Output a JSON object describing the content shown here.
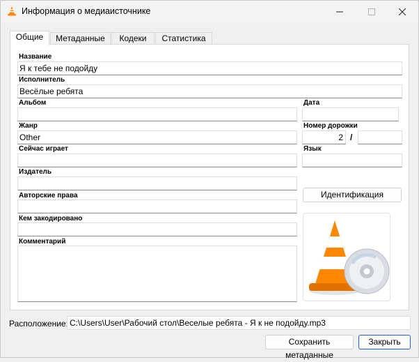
{
  "window": {
    "title": "Информация о медиаисточнике",
    "icon": "vlc-cone-icon",
    "controls": [
      "minimize-icon",
      "maximize-icon",
      "close-icon"
    ]
  },
  "tabs": [
    {
      "label": "Общие",
      "active": true
    },
    {
      "label": "Метаданные",
      "active": false
    },
    {
      "label": "Кодеки",
      "active": false
    },
    {
      "label": "Статистика",
      "active": false
    }
  ],
  "general": {
    "title": {
      "label": "Название",
      "value": "Я к тебе не подойду"
    },
    "artist": {
      "label": "Исполнитель",
      "value": "Весёлые ребята"
    },
    "album": {
      "label": "Альбом",
      "value": ""
    },
    "date": {
      "label": "Дата",
      "value": ""
    },
    "genre": {
      "label": "Жанр",
      "value": "Other"
    },
    "track": {
      "label": "Номер дорожки",
      "number": "2",
      "separator": "/",
      "total": ""
    },
    "now_playing": {
      "label": "Сейчас играет",
      "value": ""
    },
    "language": {
      "label": "Язык",
      "value": ""
    },
    "publisher": {
      "label": "Издатель",
      "value": ""
    },
    "copyright": {
      "label": "Авторские права",
      "value": ""
    },
    "encoded_by": {
      "label": "Кем закодировано",
      "value": ""
    },
    "comment": {
      "label": "Комментарий",
      "value": ""
    },
    "identify_button": "Идентификация",
    "artwork_icon": "vlc-cone-disc-icon"
  },
  "footer": {
    "location_label": "Расположение:",
    "location_value": "C:\\Users\\User\\Рабочий стол\\Веселые ребята - Я к не подойду.mp3",
    "save_button": "Сохранить метаданные",
    "close_button": "Закрыть"
  },
  "colors": {
    "cone_orange": "#ff8800",
    "accent_border": "#2166c4"
  }
}
